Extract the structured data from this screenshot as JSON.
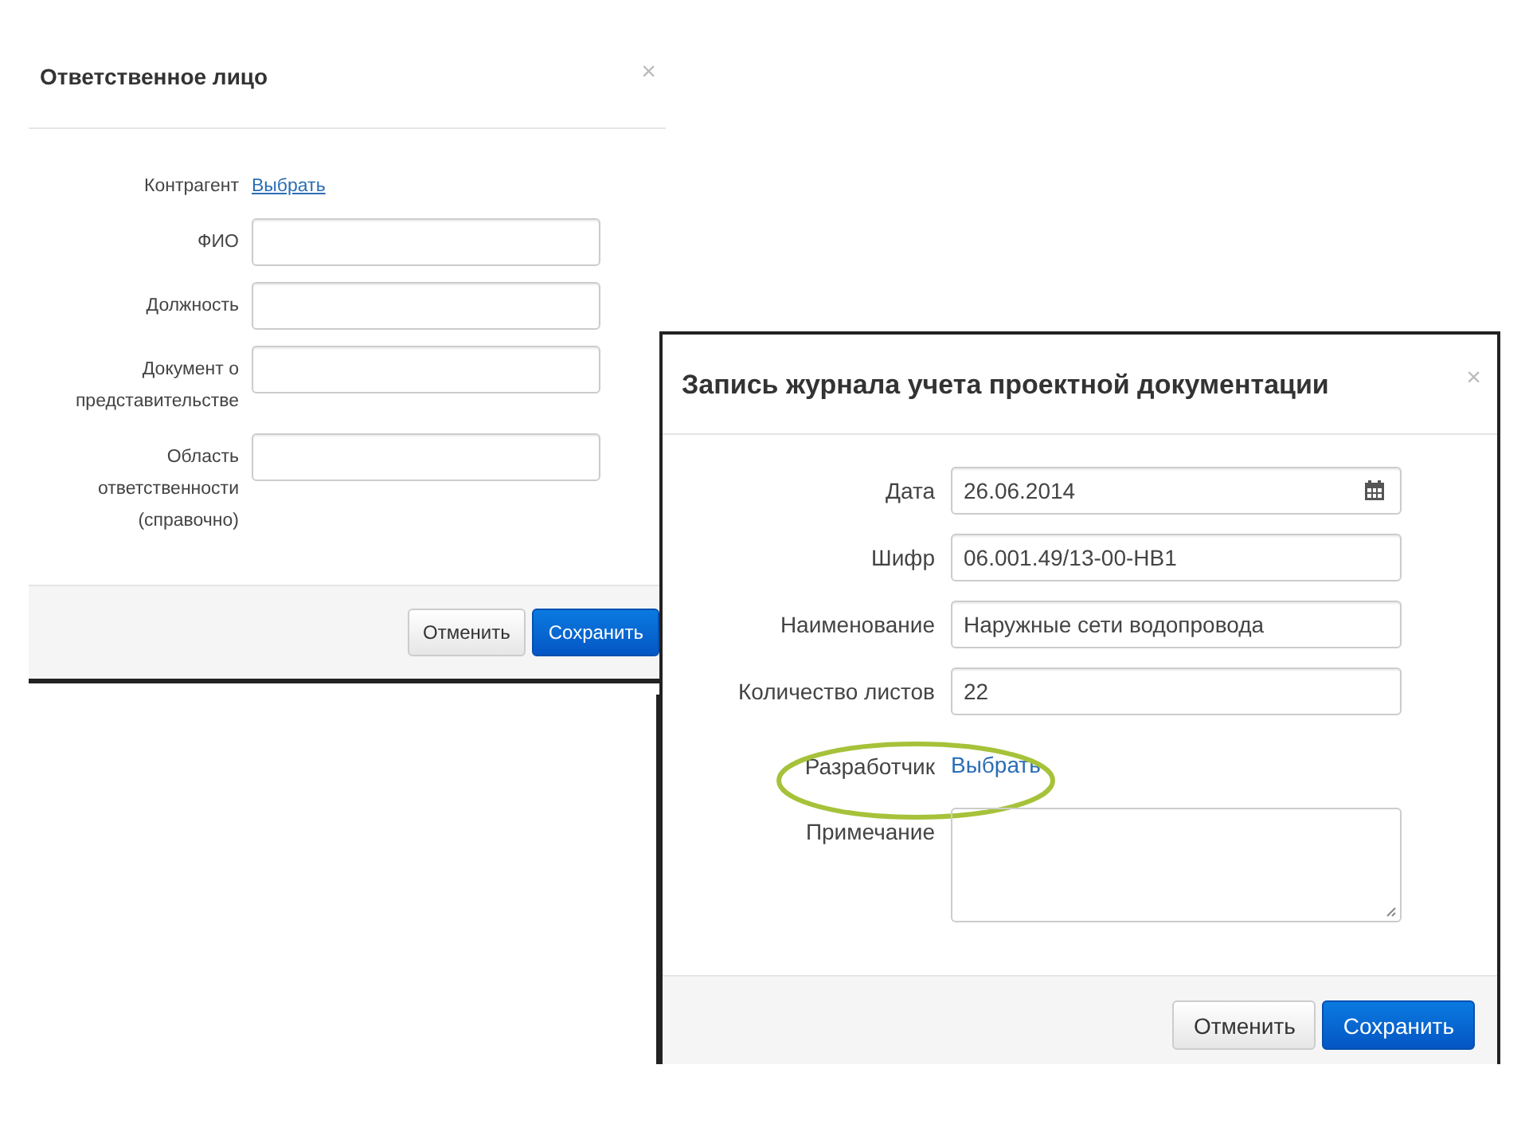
{
  "dialogs": [
    {
      "title": "Ответственное лицо",
      "close": "×",
      "fields": [
        {
          "kind": "link",
          "label": "Контрагент",
          "link": "Выбрать",
          "highlighted": false
        },
        {
          "kind": "input",
          "label": "ФИО",
          "highlighted": false
        },
        {
          "kind": "input",
          "label": "Должность",
          "highlighted": false
        },
        {
          "kind": "input",
          "label": "Документ о представительстве",
          "highlighted": false
        },
        {
          "kind": "input",
          "label": "Область ответственности (справочно)",
          "highlighted": false
        }
      ],
      "buttons": [
        {
          "label": "Отменить",
          "kind": "default"
        },
        {
          "label": "Сохранить",
          "kind": "primary"
        }
      ]
    },
    {
      "title": "Запись журнала учета проектной документации",
      "close": "×",
      "fields": [
        {
          "kind": "date",
          "label": "Дата",
          "value": "26.06.2014",
          "highlighted": false
        },
        {
          "kind": "input",
          "label": "Шифр",
          "value": "06.001.49/13-00-НВ1",
          "highlighted": false
        },
        {
          "kind": "input",
          "label": "Наименование",
          "value": "Наружные сети водопровода",
          "highlighted": false
        },
        {
          "kind": "input",
          "label": "Количество листов",
          "value": "22",
          "highlighted": false
        },
        {
          "kind": "link",
          "label": "Разработчик",
          "link": "Выбрать",
          "highlighted": true
        },
        {
          "kind": "textarea",
          "label": "Примечание",
          "highlighted": false
        }
      ],
      "buttons": [
        {
          "label": "Отменить",
          "kind": "default"
        },
        {
          "label": "Сохранить",
          "kind": "primary"
        }
      ]
    }
  ]
}
